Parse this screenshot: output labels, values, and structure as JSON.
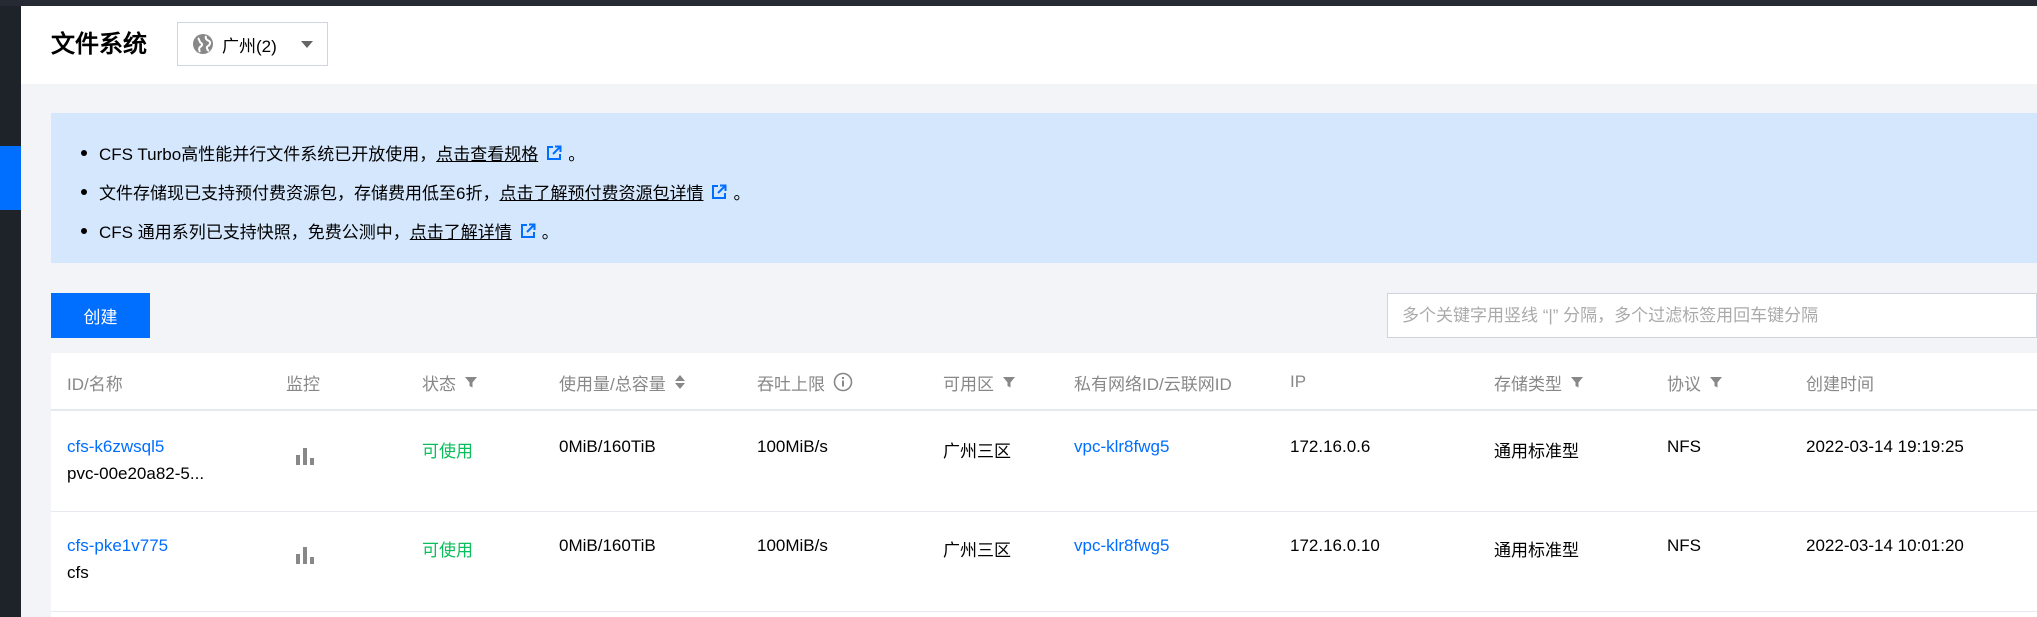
{
  "header": {
    "title": "文件系统",
    "region": "广州(2)"
  },
  "notices": [
    {
      "text": "CFS Turbo高性能并行文件系统已开放使用，",
      "link": "点击查看规格",
      "suffix": "。"
    },
    {
      "text": "文件存储现已支持预付费资源包，存储费用低至6折，",
      "link": "点击了解预付费资源包详情",
      "suffix": "。"
    },
    {
      "text": "CFS 通用系列已支持快照，免费公测中，",
      "link": "点击了解详情",
      "suffix": "。"
    }
  ],
  "toolbar": {
    "create_label": "创建",
    "search_placeholder": "多个关键字用竖线 “|” 分隔，多个过滤标签用回车键分隔"
  },
  "table": {
    "columns": {
      "id": "ID/名称",
      "monitor": "监控",
      "status": "状态",
      "usage": "使用量/总容量",
      "throughput": "吞吐上限",
      "zone": "可用区",
      "vpc": "私有网络ID/云联网ID",
      "ip": "IP",
      "storage": "存储类型",
      "protocol": "协议",
      "created": "创建时间"
    },
    "rows": [
      {
        "id": "cfs-k6zwsql5",
        "name": "pvc-00e20a82-5...",
        "status": "可使用",
        "usage": "0MiB/160TiB",
        "throughput": "100MiB/s",
        "zone": "广州三区",
        "vpc": "vpc-klr8fwg5",
        "ip": "172.16.0.6",
        "storage": "通用标准型",
        "protocol": "NFS",
        "created": "2022-03-14 19:19:25"
      },
      {
        "id": "cfs-pke1v775",
        "name": "cfs",
        "status": "可使用",
        "usage": "0MiB/160TiB",
        "throughput": "100MiB/s",
        "zone": "广州三区",
        "vpc": "vpc-klr8fwg5",
        "ip": "172.16.0.10",
        "storage": "通用标准型",
        "protocol": "NFS",
        "created": "2022-03-14 10:01:20"
      }
    ]
  },
  "colors": {
    "accent": "#006eff",
    "status_ok": "#0abf5b",
    "notice_bg": "#d5e7fd"
  }
}
